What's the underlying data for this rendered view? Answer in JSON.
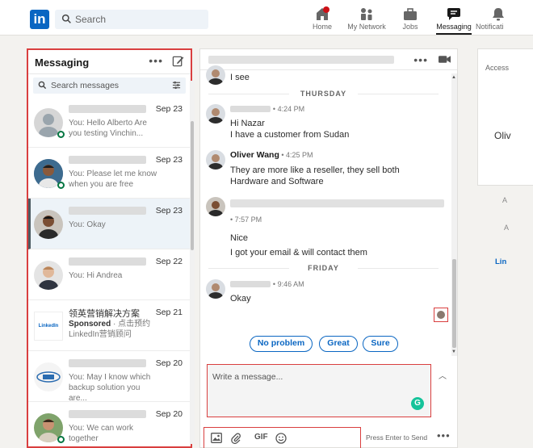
{
  "nav": {
    "logo": "in",
    "search_placeholder": "Search",
    "items": [
      {
        "label": "Home",
        "icon": "home-icon"
      },
      {
        "label": "My Network",
        "icon": "network-icon"
      },
      {
        "label": "Jobs",
        "icon": "jobs-icon"
      },
      {
        "label": "Messaging",
        "icon": "messaging-icon",
        "active": true
      },
      {
        "label": "Notificati",
        "icon": "bell-icon"
      }
    ]
  },
  "messaging": {
    "title": "Messaging",
    "more": "•••",
    "search_placeholder": "Search messages",
    "conversations": [
      {
        "date": "Sep 23",
        "preview": "You: Hello Alberto Are you testing Vinchin...",
        "online": true
      },
      {
        "date": "Sep 23",
        "preview": "You: Please let me know when you are free",
        "online": true
      },
      {
        "date": "Sep 23",
        "preview": "You: Okay",
        "online": false,
        "selected": true
      },
      {
        "date": "Sep 22",
        "preview": "You: Hi Andrea",
        "online": false
      },
      {
        "date": "Sep 21",
        "title": "领英营销解决方案",
        "sponsored": "Sponsored",
        "sponsored_suffix": " · 点击预约",
        "preview2": "LinkedIn营销顾问",
        "logo_text": "LinkedIn",
        "online": false
      },
      {
        "date": "Sep 20",
        "preview": "You: May I know which backup solution you are...",
        "online": false
      },
      {
        "date": "Sep 20",
        "preview": "You: We can work together",
        "online": true
      }
    ]
  },
  "chat": {
    "more": "•••",
    "lines": {
      "i_see": "I see",
      "thursday": "THURSDAY",
      "t1": "• 4:24 PM",
      "hi_nazar": "Hi Nazar",
      "customer": "I have a customer from Sudan",
      "oliver": "Oliver Wang",
      "t2": " • 4:25 PM",
      "reseller1": "They are more like a reseller, they sell both",
      "reseller2": "Hardware and Software",
      "t3": "• 7:57 PM",
      "nice": "Nice",
      "email": "I got your email & will contact them",
      "friday": "FRIDAY",
      "t4": "• 9:46 AM",
      "okay": "Okay"
    },
    "quick_replies": [
      "No problem",
      "Great",
      "Sure"
    ],
    "compose_placeholder": "Write a message...",
    "grammarly": "G",
    "gif": "GIF",
    "enter_hint": "Press Enter to Send"
  },
  "right": {
    "access": "Access",
    "oli": "Oliv",
    "a1": "A",
    "a2": "A",
    "lin": "Lin"
  },
  "colors": {
    "brand": "#0a66c2",
    "highlight": "#d93f3f",
    "online": "#057642"
  }
}
